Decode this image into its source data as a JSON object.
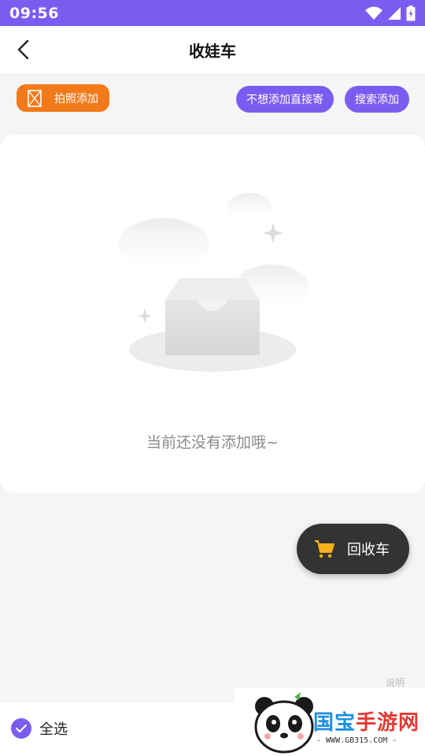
{
  "status_bar": {
    "time": "09:56"
  },
  "header": {
    "title": "收娃车"
  },
  "toolbar": {
    "photo_add_label": "拍照添加",
    "direct_send_label": "不想添加直接寄",
    "search_add_label": "搜索添加"
  },
  "empty_state": {
    "message": "当前还没有添加哦~"
  },
  "fab": {
    "label": "回收车"
  },
  "bottom_bar": {
    "select_all_label": "全选",
    "side_note": "说明"
  },
  "watermark": {
    "name_blue": "国宝",
    "name_red": "手游网",
    "url": "- WWW.GB315.COM -"
  },
  "colors": {
    "primary": "#7b5cf0",
    "accent_orange": "#f27a1a",
    "fab_bg": "#333333",
    "cart_yellow": "#f5b21b"
  },
  "icons": [
    "back-arrow-icon",
    "wifi-icon",
    "signal-icon",
    "battery-icon",
    "photo-placeholder-icon",
    "empty-box-icon",
    "cart-icon",
    "check-icon"
  ]
}
